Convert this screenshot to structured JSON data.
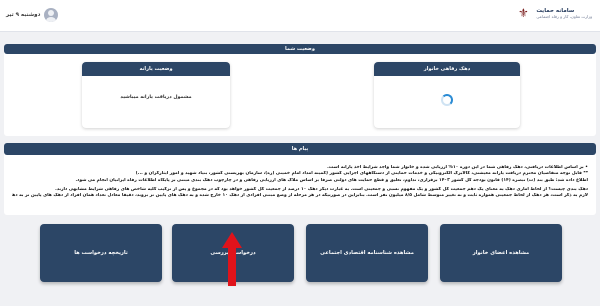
{
  "header": {
    "brand_title": "سامانه حمایت",
    "brand_subtitle": "وزارت تعاون، کار و رفاه اجتماعی",
    "date": "دوشنبه ۹ تیر"
  },
  "status": {
    "title": "وضعیت شما",
    "decile_card": {
      "title": "دهک رفاهی خانوار",
      "loading": true
    },
    "subsidy_card": {
      "title": "وضعیت یارانه",
      "text": "مشمول دریافت یارانه میباشید"
    }
  },
  "messages": {
    "title": "پیام ها",
    "lines": [
      "• بر اساس اطلاعات دریافتی، دهک رفاهی شما در این دوره ۱۰% ارزیابی شده و خانوار شما واجد شرایط اخذ یارانه است.",
      "** قابل توجه متقاضیان محترم دریافت یارانه معیشتی، کالابرگ الکترونیکی و خدمات حمایتی از دستگاههای اجرایی کشور (کمیته امداد امام خمینی (ره)، سازمان بهزیستی کشور، بنیاد شهید و امور ایثارگران و ...)",
      "اطلاع داده شد: طبق بند (ت) تبصره (۱۴) قانون بودجه کل کشور ۱۴۰۳ برقراری، تداوم، تعلیق و قطع حمایت های دولتی صرفا بر اساس ملاک های ارزیابی رفاهی و در چارچوب دهک بندی مبتنی بر پایگاه اطلاعات رفاه ایرانیان انجام می شود.",
      "",
      "دهک بندی چیست؟ از لحاظ آماری دهک به معنای یک دهم جمعیت کل کشور و یک مفهوم نسبی و جمعیتی است. به عبارت دیگر دهک ۱۰ درصد از جمعیت کل کشور خواهد بود که در مجموع و پس از ترکیب کلیه شاخص های رفاهی شرایط مشابهی دارند.",
      "لازم به ذکر است، هر دهک از لحاظ جمعیتی همواره ثابت و نه تغییر متوسط شامل ۸/۵ میلیون نفر است. بنابراین در صورتیکه در هر مرحله از وضع مبتنی افرادی از دهک ۱۰ خارج شده و به دهک های پایین تر بروند، دقیقا معادل تعداد همان افراد از دهک های پایین تر به دهک ۱۰ منتقل می شوند."
    ]
  },
  "actions": {
    "members": "مشاهده اعضای خانوار",
    "socioeconomic_id": "مشاهده شناسنامه اقتصادی اجتماعی",
    "review_request": "درخواست بررسی",
    "request_history": "تاریخچه درخواست ها"
  },
  "colors": {
    "primary": "#2c4666",
    "background": "#f0f1f4",
    "arrow": "#e0131b",
    "spinner": "#2a8bd4"
  }
}
